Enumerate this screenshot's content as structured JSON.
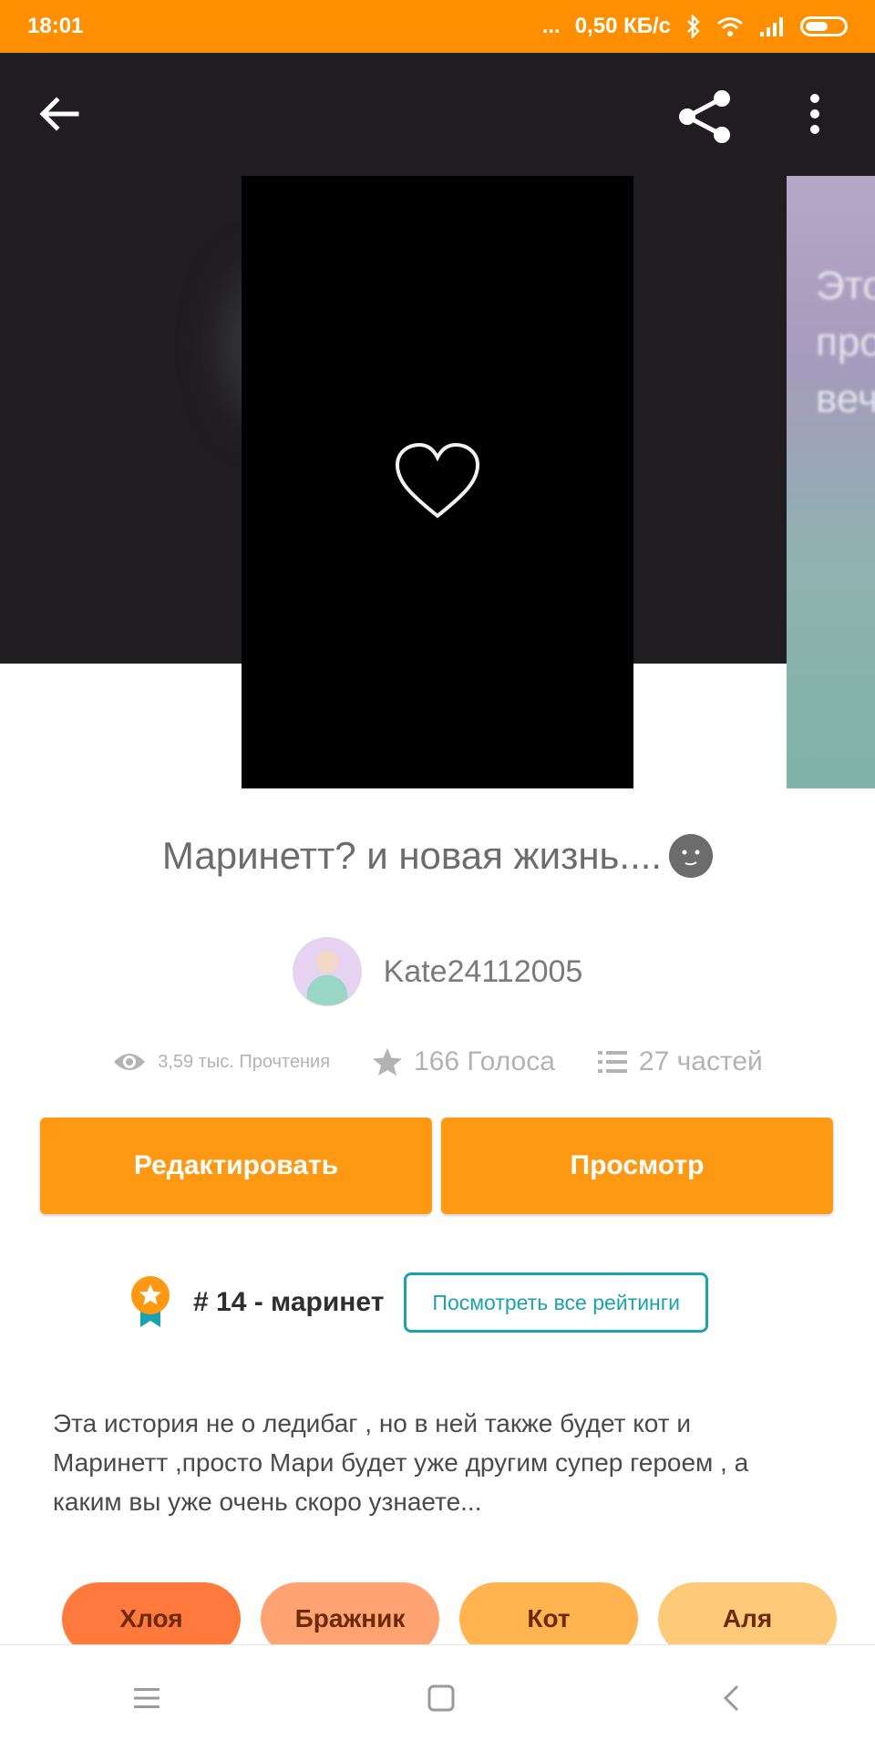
{
  "status_bar": {
    "time": "18:01",
    "dots": "...",
    "speed": "0,50 КБ/с"
  },
  "colors": {
    "accent": "#ff9812",
    "status_bar": "#ff8f00",
    "teal": "#1aa3ad",
    "hero_bg": "#1f1d20"
  },
  "toolbar": {
    "back_icon": "arrow-left-icon",
    "share_icon": "share-icon",
    "more_icon": "more-vertical-icon"
  },
  "side_cover": {
    "lines": [
      "Это",
      "про",
      "веч"
    ]
  },
  "story": {
    "title": "Маринетт? и новая жизнь....",
    "author": "Kate24112005",
    "reads": "3,59 тыс. Прочтения",
    "votes": "166 Голоса",
    "parts": "27 частей",
    "description": "Эта история не о ледибаг , но в ней также будет кот и Маринетт ,просто Мари будет уже другим супер героем , а каким вы уже  очень скоро узнаете..."
  },
  "actions": {
    "edit_label": "Редактировать",
    "view_label": "Просмотр"
  },
  "ranking": {
    "text": "# 14 - маринет",
    "all_label": "Посмотреть все рейтинги"
  },
  "tags": [
    {
      "label": "Хлоя",
      "color": "#ff7a3c"
    },
    {
      "label": "Бражник",
      "color": "#ffa373"
    },
    {
      "label": "Кот",
      "color": "#ffb44f"
    },
    {
      "label": "Аля",
      "color": "#ffc97a"
    }
  ]
}
